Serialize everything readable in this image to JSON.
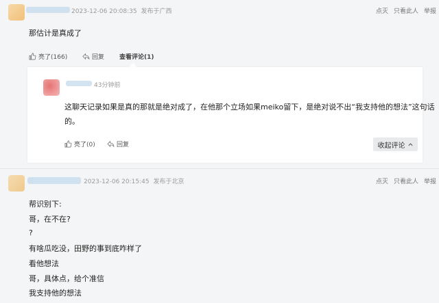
{
  "comment1": {
    "timestamp": "2023-12-06 20:08:35",
    "location": "发布于广西",
    "body": "那估计是真成了",
    "like_label": "亮了(166)",
    "reply_label": "回复",
    "view_replies_label": "查看评论(1)",
    "actions": [
      "点灭",
      "只看此人",
      "举报"
    ]
  },
  "reply1": {
    "time": "43分钟前",
    "line1": "这聊天记录如果是真的那就是绝对成了，在他那个立场如果meiko留下，是绝对说不出“我支持他的想法”这句话",
    "line2": "的。",
    "like_label": "亮了(0)",
    "reply_label": "回复",
    "collapse_label": "收起评论"
  },
  "comment2": {
    "timestamp": "2023-12-06 20:15:45",
    "location": "发布于北京",
    "actions": [
      "点灭",
      "只看此人",
      "举报"
    ],
    "lines": [
      "帮识别下:",
      "哥，在不在?",
      "?",
      "有啥瓜吃没，田野的事到底咋样了",
      "看他想法",
      "哥，具体点，给个准信",
      "我支持他的想法"
    ]
  },
  "colors": {
    "background": "#f4f5f7",
    "panel": "#ffffff",
    "meta": "#9a9a9a"
  },
  "icons": [
    "thumbs-up-icon",
    "reply-arrow-icon",
    "chevron-up-icon"
  ]
}
